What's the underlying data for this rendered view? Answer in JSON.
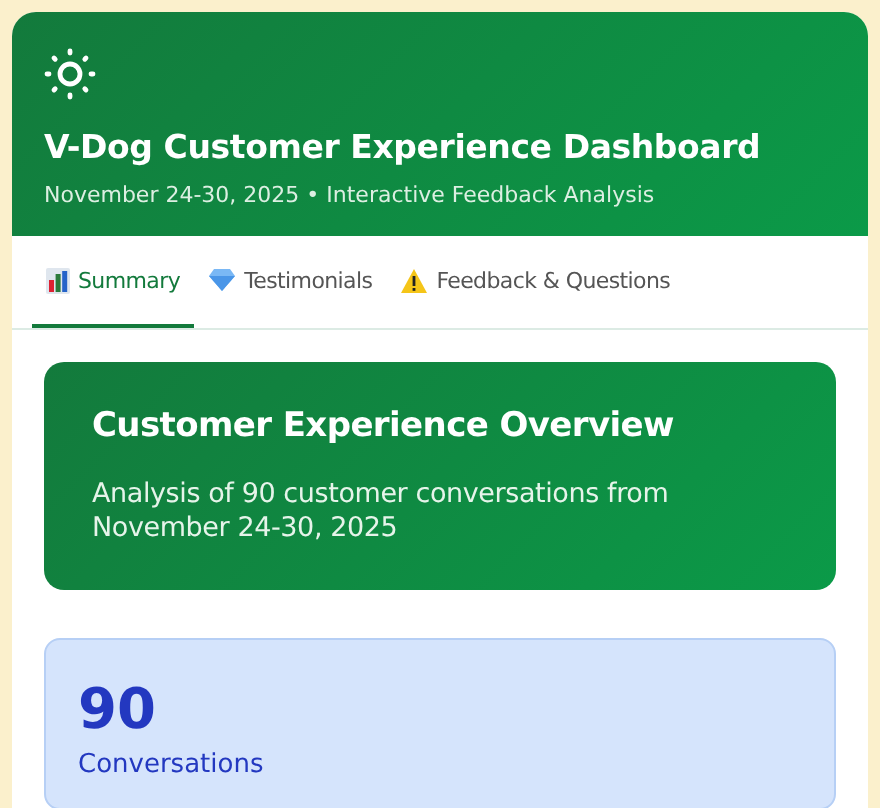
{
  "header": {
    "title": "V-Dog Customer Experience Dashboard",
    "subtitle": "November 24-30, 2025 • Interactive Feedback Analysis"
  },
  "tabs": [
    {
      "label": "Summary",
      "kind": "chart",
      "selected": true
    },
    {
      "label": "Testimonials",
      "kind": "gem",
      "selected": false
    },
    {
      "label": "Feedback & Questions",
      "kind": "warning",
      "selected": false
    }
  ],
  "overview": {
    "title": "Customer Experience Overview",
    "text": "Analysis of 90 customer conversations from November 24-30, 2025"
  },
  "stats": [
    {
      "value": "90",
      "label": "Conversations"
    }
  ]
}
